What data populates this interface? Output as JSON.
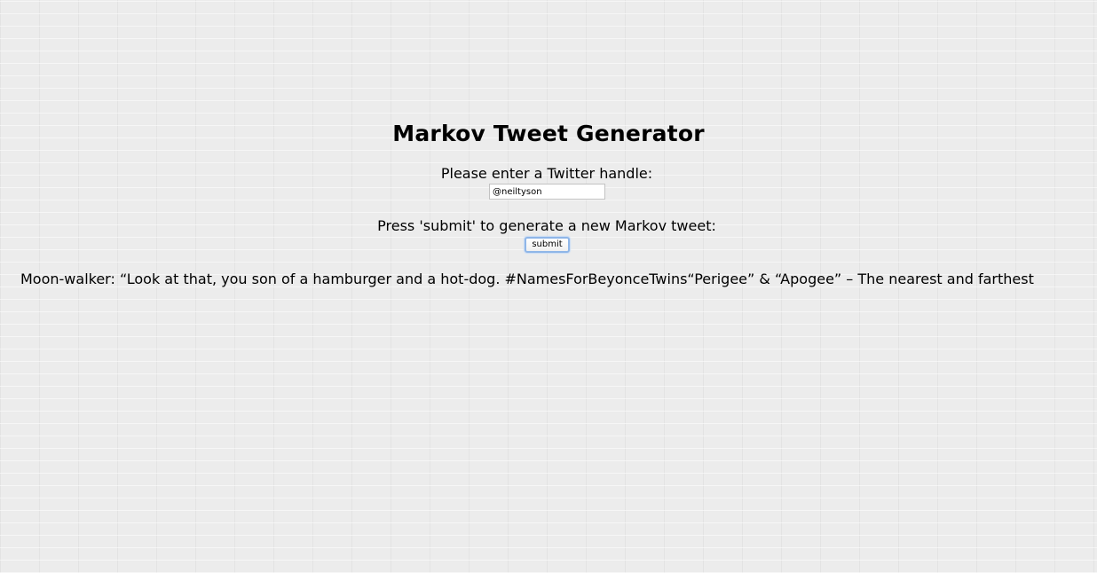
{
  "page": {
    "title": "Markov Tweet Generator",
    "handle_prompt": "Please enter a Twitter handle:",
    "handle_value": "@neiltyson",
    "submit_prompt": "Press 'submit' to generate a new Markov tweet:",
    "submit_label": "submit",
    "generated_tweet": "Moon-walker: “Look at that, you son of a hamburger and a hot-dog. #NamesForBeyonceTwins“Perigee” & “Apogee” – The nearest and farthest"
  },
  "colors": {
    "background": "#ececec",
    "button_focus_ring": "#8fb6e8"
  }
}
